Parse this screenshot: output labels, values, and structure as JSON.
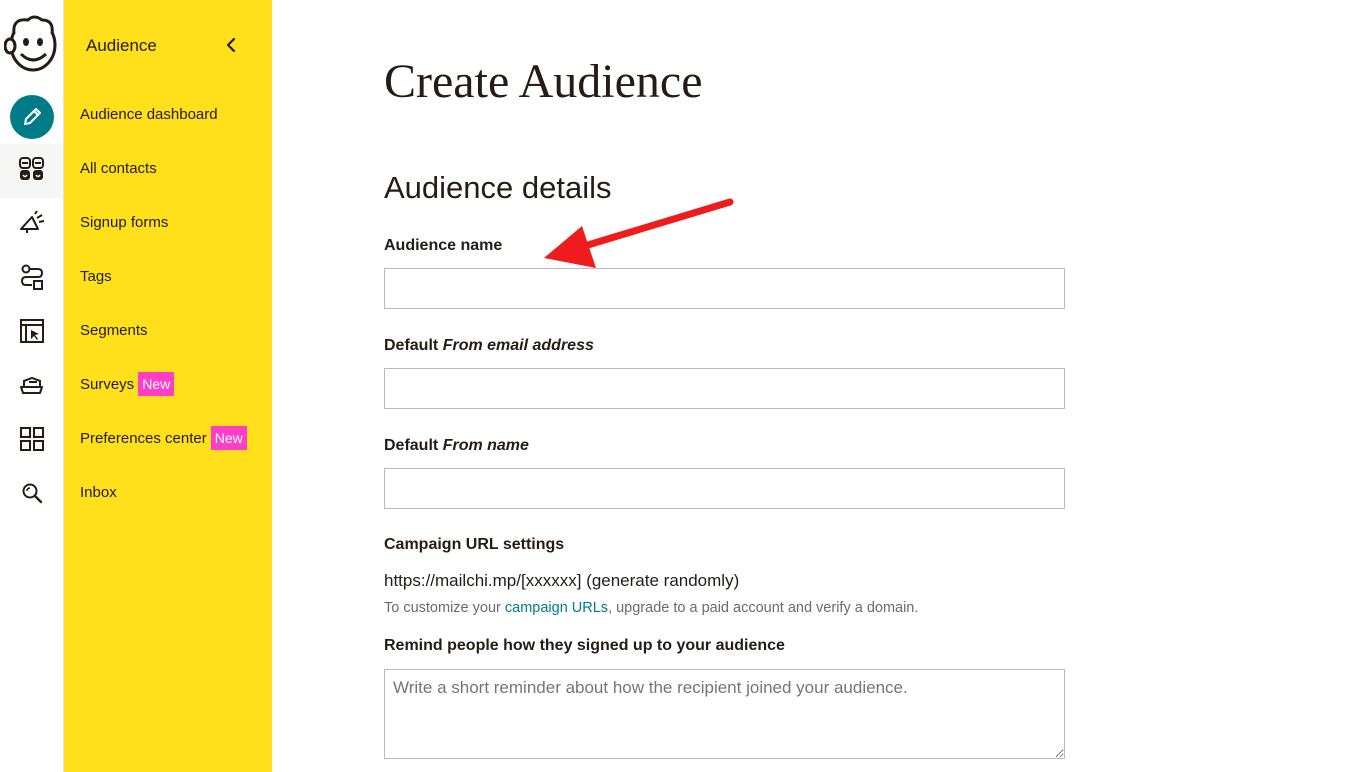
{
  "rail": {
    "logo_icon": "mailchimp-freddie-logo",
    "items": [
      {
        "icon": "pencil-icon",
        "name": "create"
      },
      {
        "icon": "audience-icon",
        "name": "audience"
      },
      {
        "icon": "megaphone-icon",
        "name": "campaigns"
      },
      {
        "icon": "automations-icon",
        "name": "automations"
      },
      {
        "icon": "website-icon",
        "name": "website"
      },
      {
        "icon": "content-studio-icon",
        "name": "content"
      },
      {
        "icon": "integrations-grid-icon",
        "name": "integrations"
      },
      {
        "icon": "search-icon",
        "name": "search"
      }
    ],
    "accent_color": "#007c89"
  },
  "subnav": {
    "title": "Audience",
    "background_color": "#ffe01b",
    "items": [
      {
        "label": "Audience dashboard"
      },
      {
        "label": "All contacts"
      },
      {
        "label": "Signup forms"
      },
      {
        "label": "Tags"
      },
      {
        "label": "Segments"
      },
      {
        "label": "Surveys",
        "badge": "New"
      },
      {
        "label": "Preferences center",
        "badge": "New"
      },
      {
        "label": "Inbox"
      }
    ],
    "badge_color": "#ff3ec8"
  },
  "main": {
    "page_title": "Create Audience",
    "section_title": "Audience details",
    "fields": {
      "audience_name": {
        "label": "Audience name",
        "value": ""
      },
      "from_email": {
        "label_prefix": "Default",
        "label_italic": "From email address",
        "value": ""
      },
      "from_name": {
        "label_prefix": "Default",
        "label_italic": "From name",
        "value": ""
      }
    },
    "campaign_url": {
      "label": "Campaign URL settings",
      "value": "https://mailchi.mp/[xxxxxx] (generate randomly)",
      "help_before": "To customize your ",
      "help_link": "campaign URLs",
      "help_after": ", upgrade to a paid account and verify a domain."
    },
    "reminder": {
      "label": "Remind people how they signed up to your audience",
      "placeholder": "Write a short reminder about how the recipient joined your audience."
    }
  },
  "annotation": {
    "icon": "red-arrow-annotation",
    "color": "#ee1c1c"
  }
}
